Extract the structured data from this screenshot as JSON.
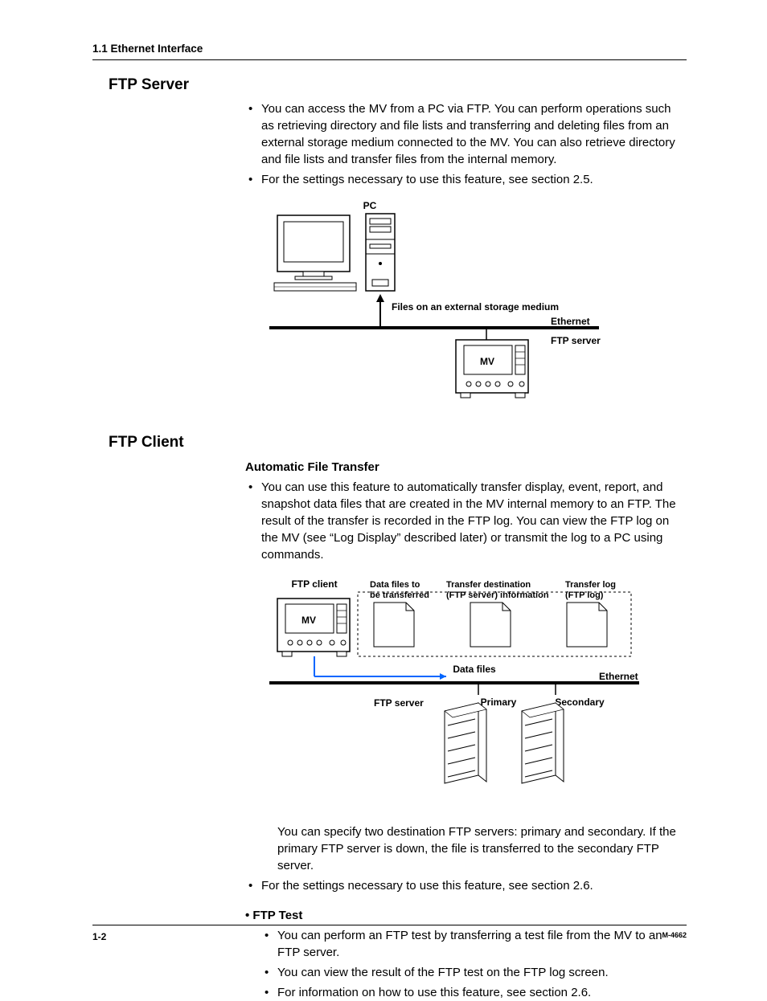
{
  "header": {
    "running": "1.1  Ethernet Interface"
  },
  "ftp_server": {
    "title": "FTP Server",
    "bullets": [
      "You can access the MV from a PC via FTP. You can perform operations such as retrieving directory and file lists and transferring and deleting files from an external storage medium connected to the MV. You can also retrieve directory and file lists and transfer files from the internal memory.",
      "For the settings necessary to use this feature, see section 2.5."
    ],
    "diagram": {
      "pc_label": "PC",
      "files_label": "Files on an external storage medium",
      "ethernet_label": "Ethernet",
      "ftp_server_label": "FTP server",
      "mv_label": "MV"
    }
  },
  "ftp_client": {
    "title": "FTP Client",
    "auto_transfer": {
      "heading": "Automatic File Transfer",
      "bullets": [
        "You can use this feature to automatically transfer display, event, report, and snapshot data files that are created in the MV internal memory to an FTP. The result of the transfer is recorded in the FTP log. You can view the FTP log on the MV (see “Log Display” described later) or transmit the log to a PC using commands."
      ],
      "note": "You can specify two destination FTP servers: primary and secondary. If the primary FTP server is down, the file is transferred to the secondary FTP server.",
      "settings_bullet": "For the settings necessary to use this feature, see section 2.6.",
      "diagram": {
        "ftp_client_label": "FTP client",
        "mv_label": "MV",
        "datafiles_heading": "Data files to be transferred",
        "dest_heading": "Transfer destination (FTP server) information",
        "log_heading": "Transfer log (FTP log)",
        "data_files_label": "Data files",
        "ethernet_label": "Ethernet",
        "ftp_server_label": "FTP server",
        "primary_label": "Primary",
        "secondary_label": "Secondary"
      }
    },
    "ftp_test": {
      "heading": "FTP Test",
      "bullets": [
        "You can perform an FTP test by transferring a test file from the MV to an FTP server.",
        "You can view the result of the FTP test on the FTP log screen.",
        "For information on how to use this feature, see section 2.6."
      ]
    }
  },
  "footer": {
    "page": "1-2",
    "doc_id": "M-4662"
  }
}
